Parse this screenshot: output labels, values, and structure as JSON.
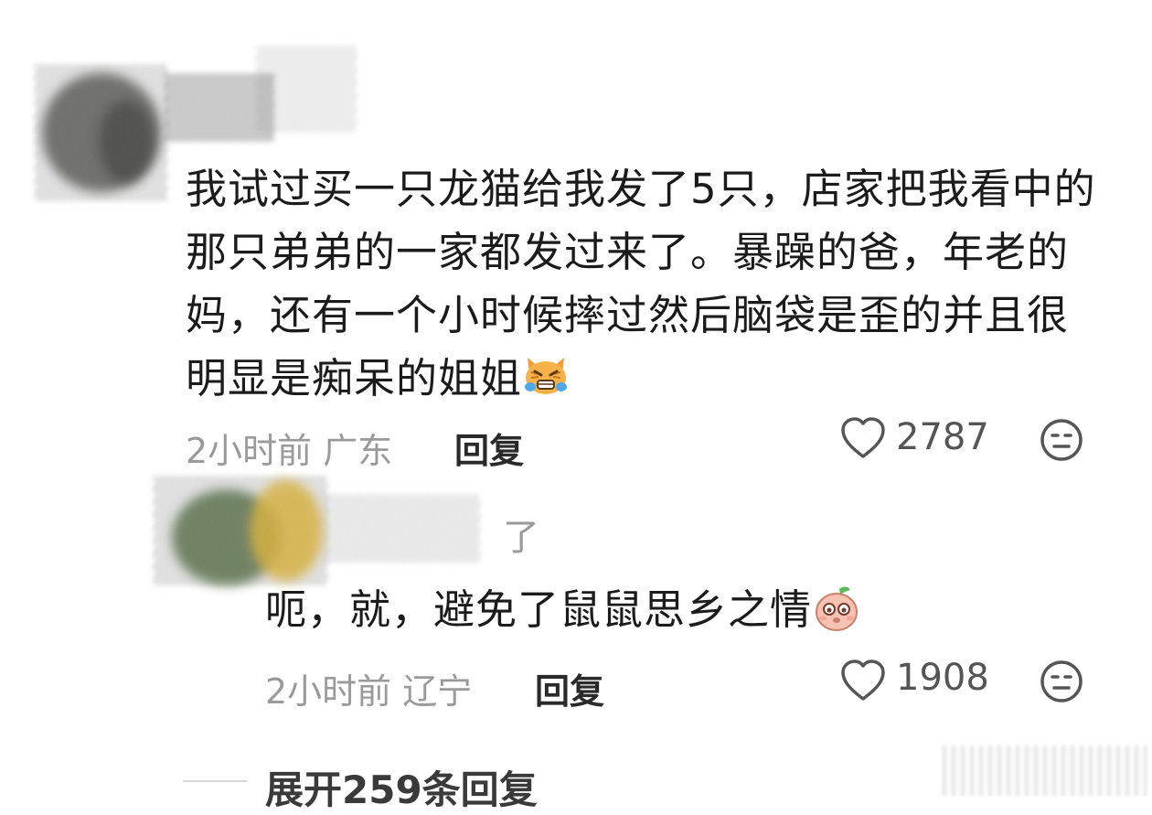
{
  "comment": {
    "text": "我试过买一只龙猫给我发了5只，店家把我看中的那只弟弟的一家都发过来了。暴躁的爸，年老的妈，还有一个小时候摔过然后脑袋是歪的并且很明显是痴呆的姐姐",
    "time": "2小时前",
    "location": "广东",
    "reply_label": "回复",
    "likes": "2787",
    "emoji": "crying-cat-emoji"
  },
  "reply": {
    "name_fragment": "了",
    "text": "呃，就，避免了鼠鼠思乡之情",
    "time": "2小时前",
    "location": "辽宁",
    "reply_label": "回复",
    "likes": "1908",
    "emoji": "pleading-peach-emoji"
  },
  "expand": {
    "label": "展开259条回复"
  }
}
